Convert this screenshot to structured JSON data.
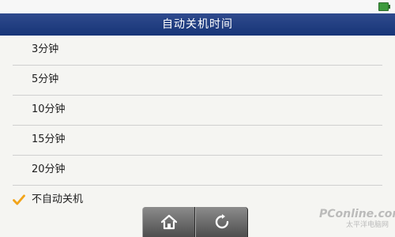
{
  "status": {
    "battery_icon": "battery-icon",
    "battery_color": "#3c9a3c"
  },
  "header": {
    "title": "自动关机时间"
  },
  "options": [
    {
      "label": "3分钟"
    },
    {
      "label": "5分钟"
    },
    {
      "label": "10分钟"
    },
    {
      "label": "15分钟"
    },
    {
      "label": "20分钟"
    },
    {
      "label": "不自动关机",
      "checked": true
    }
  ],
  "nav": {
    "home_icon": "home-icon",
    "back_icon": "refresh-icon"
  },
  "watermark": {
    "logo": "PConline.com",
    "subtitle": "太平洋电脑网"
  },
  "colors": {
    "header_bg": "#1c3a7e",
    "check": "#f2a41a"
  }
}
